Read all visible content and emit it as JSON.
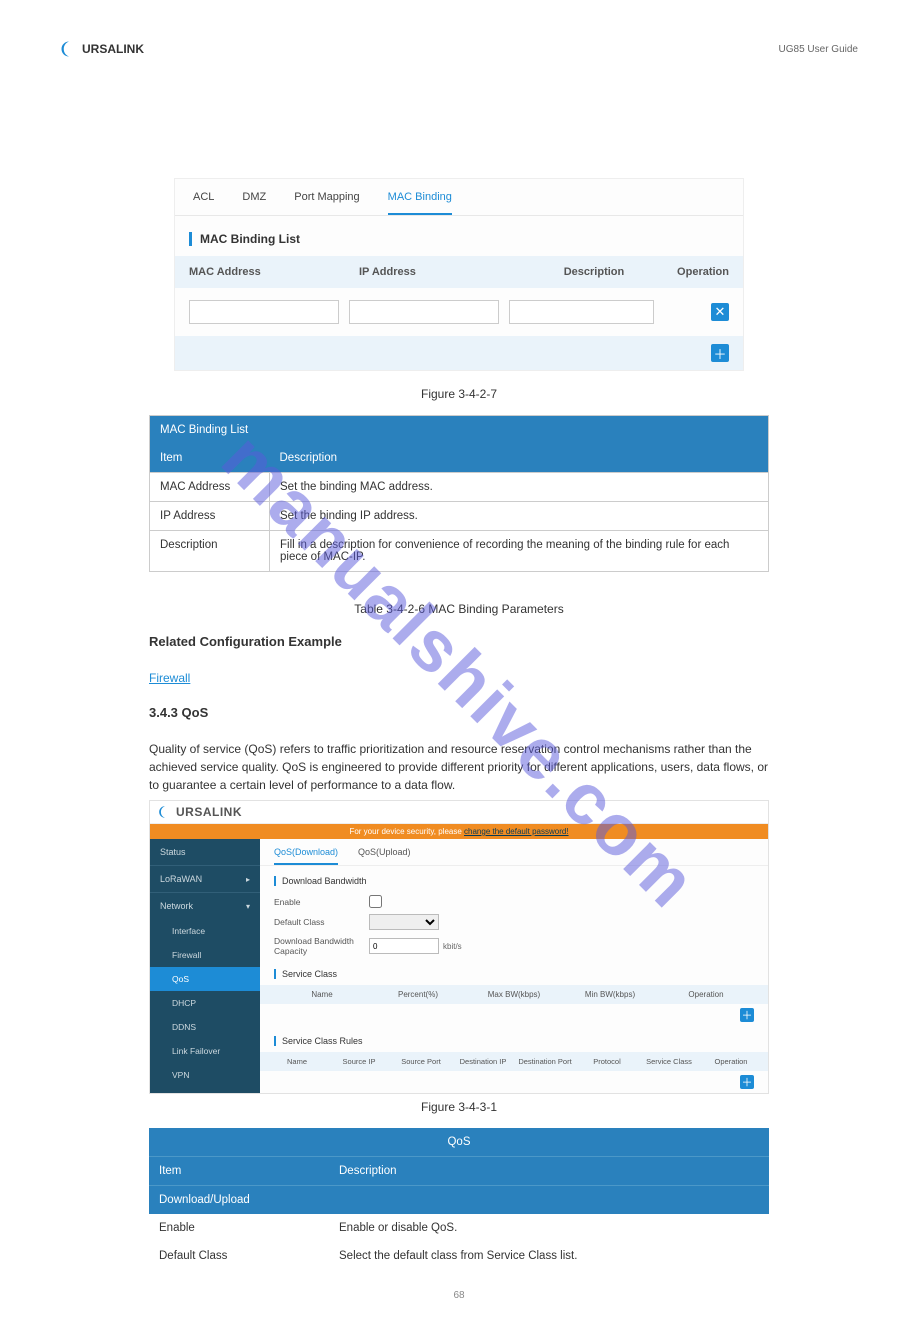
{
  "header": {
    "brand": "URSALINK",
    "subtitle": "UG85 User Guide"
  },
  "watermark": "manualshive.com",
  "tabs": {
    "acl": "ACL",
    "dmz": "DMZ",
    "port_mapping": "Port Mapping",
    "mac_binding": "MAC Binding"
  },
  "section1_title": "MAC Binding List",
  "table1": {
    "col_mac": "MAC Address",
    "col_ip": "IP Address",
    "col_desc": "Description",
    "col_op": "Operation"
  },
  "caption1": "Figure 3-4-2-7",
  "info": {
    "title": "MAC Binding List",
    "item_label": "Item",
    "desc_label": "Description",
    "rows": [
      {
        "item": "MAC Address",
        "desc": "Set the binding MAC address."
      },
      {
        "item": "IP Address",
        "desc": "Set the binding IP address."
      },
      {
        "item": "Description",
        "desc": "Fill in a description for convenience of recording the meaning of the binding rule for each piece of MAC-IP."
      }
    ]
  },
  "info_table_caption": "Table 3-4-2-6 MAC Binding Parameters",
  "related": {
    "title": "Related Configuration Example",
    "link": "Firewall"
  },
  "qos_sec_title": "3.4.3 QoS",
  "qos_intro": "Quality of service (QoS) refers to traffic prioritization and resource reservation control mechanisms rather than the achieved service quality. QoS is engineered to provide different priority for different applications, users, data flows, or to guarantee a certain level of performance to a data flow.",
  "shot2": {
    "logo": "URSALINK",
    "banner_prefix": "For your device security, please ",
    "banner_link": "change the default password!",
    "sidebar": {
      "status": "Status",
      "lorawan": "LoRaWAN",
      "network": "Network",
      "interface": "Interface",
      "firewall": "Firewall",
      "qos": "QoS",
      "dhcp": "DHCP",
      "ddns": "DDNS",
      "link_failover": "Link Failover",
      "vpn": "VPN"
    },
    "tabs": {
      "down": "QoS(Download)",
      "up": "QoS(Upload)"
    },
    "sec_download_bw": "Download Bandwidth",
    "enable_label": "Enable",
    "default_class_label": "Default Class",
    "dl_bw_cap_label": "Download Bandwidth Capacity",
    "dl_bw_value": "0",
    "dl_bw_unit": "kbit/s",
    "sec_svc_class": "Service Class",
    "svc_class_cols": {
      "name": "Name",
      "percent": "Percent(%)",
      "maxbw": "Max BW(kbps)",
      "minbw": "Min BW(kbps)",
      "op": "Operation"
    },
    "sec_svc_rules": "Service Class Rules",
    "svc_rules_cols": {
      "name": "Name",
      "srcip": "Source IP",
      "srcport": "Source Port",
      "dstip": "Destination IP",
      "dstport": "Destination Port",
      "proto": "Protocol",
      "svc": "Service Class",
      "op": "Operation"
    }
  },
  "caption2": "Figure 3-4-3-1",
  "qosdesc": {
    "title": "QoS",
    "item_label": "Item",
    "desc_label": "Description",
    "sub": "Download/Upload",
    "rows": [
      {
        "item": "Enable",
        "desc": "Enable or disable QoS."
      },
      {
        "item": "Default Class",
        "desc": "Select the default class from Service Class list."
      }
    ]
  },
  "page_number": "68"
}
